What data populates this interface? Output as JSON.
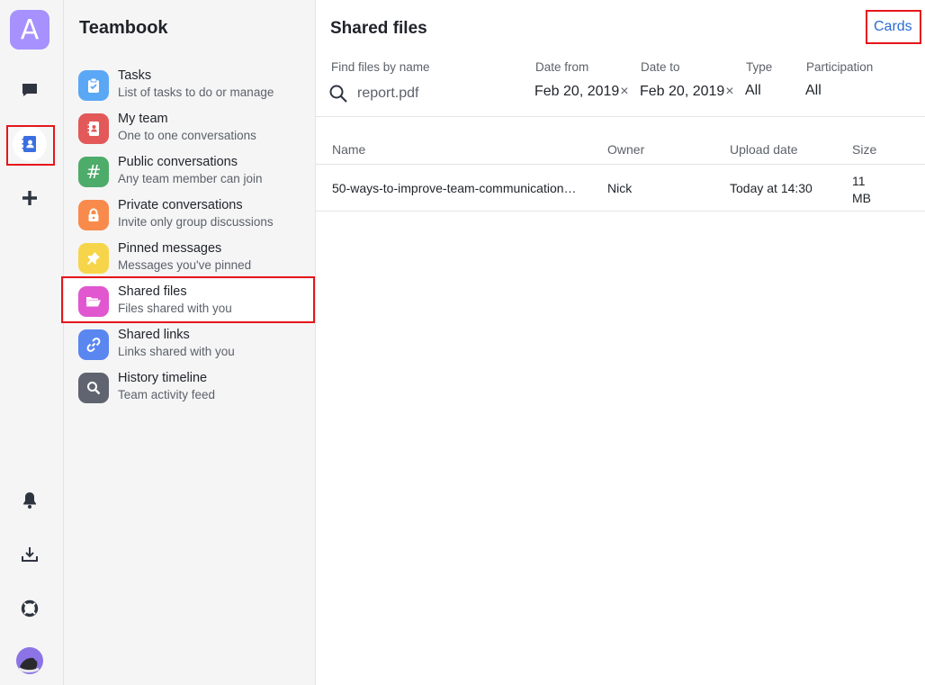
{
  "rail": {
    "avatar_letter": "A",
    "items": [
      {
        "icon": "chat-icon"
      },
      {
        "icon": "contacts-book-icon",
        "active": true
      },
      {
        "icon": "plus-icon"
      }
    ],
    "bottom": [
      {
        "icon": "bell-icon"
      },
      {
        "icon": "download-icon"
      },
      {
        "icon": "lifebuoy-icon"
      },
      {
        "icon": "user-avatar"
      }
    ]
  },
  "sidebar": {
    "title": "Teambook",
    "items": [
      {
        "label": "Tasks",
        "sub": "List of tasks to do or manage",
        "color": "#5aa8f5",
        "icon": "clipboard-icon"
      },
      {
        "label": "My team",
        "sub": "One to one conversations",
        "color": "#e35959",
        "icon": "address-book-icon"
      },
      {
        "label": "Public conversations",
        "sub": "Any team member can join",
        "color": "#4eac6a",
        "icon": "hash-icon",
        "glyph": "#"
      },
      {
        "label": "Private conversations",
        "sub": "Invite only group discussions",
        "color": "#f88a4c",
        "icon": "lock-icon"
      },
      {
        "label": "Pinned messages",
        "sub": "Messages you've pinned",
        "color": "#f7d54a",
        "icon": "pin-icon"
      },
      {
        "label": "Shared files",
        "sub": "Files shared with you",
        "color": "#e057d0",
        "icon": "folder-open-icon",
        "active": true
      },
      {
        "label": "Shared links",
        "sub": "Links shared with you",
        "color": "#5a86f0",
        "icon": "link-icon"
      },
      {
        "label": "History timeline",
        "sub": "Team activity feed",
        "color": "#5f6470",
        "icon": "search-icon"
      }
    ]
  },
  "main": {
    "title": "Shared files",
    "view_toggle": "Cards",
    "filters": {
      "name_label": "Find files by name",
      "name_value": "report.pdf",
      "date_from_label": "Date from",
      "date_from_value": "Feb 20, 2019",
      "date_to_label": "Date to",
      "date_to_value": "Feb 20, 2019",
      "type_label": "Type",
      "type_value": "All",
      "participation_label": "Participation",
      "participation_value": "All",
      "clear_glyph": "×"
    },
    "table": {
      "headers": {
        "name": "Name",
        "owner": "Owner",
        "upload_date": "Upload date",
        "size": "Size"
      },
      "rows": [
        {
          "name": "50-ways-to-improve-team-communication…",
          "owner": "Nick",
          "upload_date": "Today at 14:30",
          "size_value": "11",
          "size_unit": "MB"
        }
      ]
    }
  },
  "colors": {
    "accent": "#2a6bd6",
    "highlight": "#e5161b",
    "rail_active_icon": "#3b6fe0"
  }
}
